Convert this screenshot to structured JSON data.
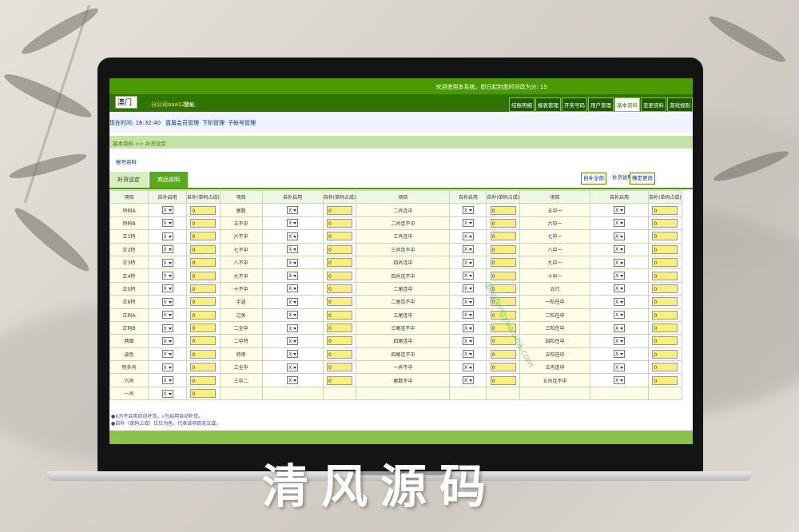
{
  "header": {
    "welcome": "欢迎使用本系统。即日起封盘时间改为分: 15",
    "region_select": "澳门",
    "account": "分公司aaa1234",
    "logout": "登出",
    "nav_tabs": [
      "结账明细",
      "报表管理",
      "开奖号码",
      "用户管理",
      "基本资料",
      "变更资料",
      "游戏规则"
    ],
    "active_tab": "基本资料"
  },
  "timebar": {
    "clock": "现在时间: 16:32:40",
    "links": [
      "直属会员管理",
      "下阶管理",
      "子帐号管理"
    ]
  },
  "breadcrumb": "基本资料 >> 补货设定",
  "account_info": "帐号资料",
  "subtabs": {
    "active": "补货设定",
    "other": "商品说明"
  },
  "actions": {
    "auto_all": "自补全部",
    "help": "补货说明?",
    "confirm": "确定更改"
  },
  "table": {
    "headers": [
      "项目",
      "自补启用",
      "自补(单码占成)"
    ],
    "default_select": "X",
    "default_value": "0",
    "col1": [
      "特码A",
      "特码B",
      "正1特",
      "正2特",
      "正3特",
      "正4特",
      "正5特",
      "正6特",
      "正码A",
      "正码B",
      "两面",
      "波色",
      "特多肖",
      "六肖",
      "一肖"
    ],
    "col2": [
      "尾数",
      "五不中",
      "六不中",
      "七不中",
      "八不中",
      "九不中",
      "十不中",
      "半波",
      "过关",
      "二全中",
      "二中特",
      "特串",
      "三全中",
      "三中二"
    ],
    "col3": [
      "二肖连中",
      "二肖连不中",
      "三肖连中",
      "三肖连不中",
      "四肖连中",
      "四肖连不中",
      "二尾连中",
      "二尾连不中",
      "三尾连中",
      "三尾连不中",
      "四尾连中",
      "四尾连不中",
      "一肖不中",
      "尾数不中"
    ],
    "col4": [
      "五中一",
      "六中一",
      "七中一",
      "八中一",
      "九中一",
      "十中一",
      "五行",
      "一粒任中",
      "二粒任中",
      "三粒任中",
      "四粒任中",
      "五粒任中",
      "五肖连中",
      "五肖连不中"
    ]
  },
  "notes": [
    "●X为不启用自动补货，√为启用自动补货。",
    "●自补（单码占成）位位为色，代表该项目无法或。"
  ],
  "watermark": "qingfengyuanma.com",
  "caption": "清风源码"
}
